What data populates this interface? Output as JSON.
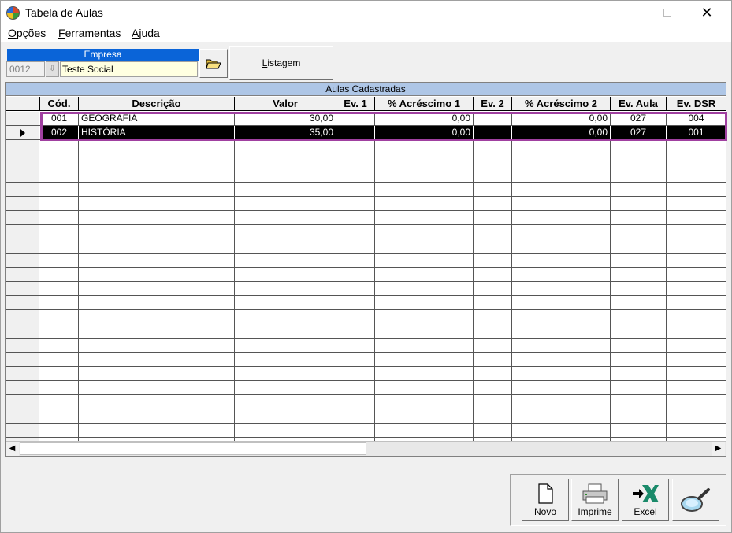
{
  "window": {
    "title": "Tabela de Aulas"
  },
  "menu": [
    {
      "label": "Opções",
      "mnemonic": "O",
      "rest": "pções"
    },
    {
      "label": "Ferramentas",
      "mnemonic": "F",
      "rest": "erramentas"
    },
    {
      "label": "Ajuda",
      "mnemonic": "A",
      "rest": "juda"
    }
  ],
  "empresa": {
    "label": "Empresa",
    "code": "0012",
    "name": "Teste Social"
  },
  "toolbar": {
    "listagem_label": "Listagem",
    "listagem_mnemonic": "L",
    "listagem_rest": "istagem"
  },
  "grid": {
    "title": "Aulas Cadastradas",
    "columns": [
      "Cód.",
      "Descrição",
      "Valor",
      "Ev. 1",
      "% Acréscimo 1",
      "Ev. 2",
      "% Acréscimo 2",
      "Ev. Aula",
      "Ev. DSR"
    ],
    "rows": [
      {
        "cod": "001",
        "descricao": "GEOGRAFIA",
        "valor": "30,00",
        "ev1": "",
        "acrescimo1": "0,00",
        "ev2": "",
        "acrescimo2": "0,00",
        "ev_aula": "027",
        "ev_dsr": "004",
        "selected": false
      },
      {
        "cod": "002",
        "descricao": "HISTÓRIA",
        "valor": "35,00",
        "ev1": "",
        "acrescimo1": "0,00",
        "ev2": "",
        "acrescimo2": "0,00",
        "ev_aula": "027",
        "ev_dsr": "001",
        "selected": true
      }
    ]
  },
  "buttons": {
    "novo": {
      "label": "Novo",
      "mnemonic": "N",
      "rest": "ovo"
    },
    "imprime": {
      "label": "Imprime",
      "mnemonic": "I",
      "rest": "mprime"
    },
    "excel": {
      "label": "Excel",
      "mnemonic": "E",
      "rest": "xcel"
    }
  },
  "colors": {
    "empresa_header": "#0a64d8",
    "grid_title": "#aec6e6",
    "highlight": "#a040a0",
    "name_field": "#ffffe1"
  }
}
